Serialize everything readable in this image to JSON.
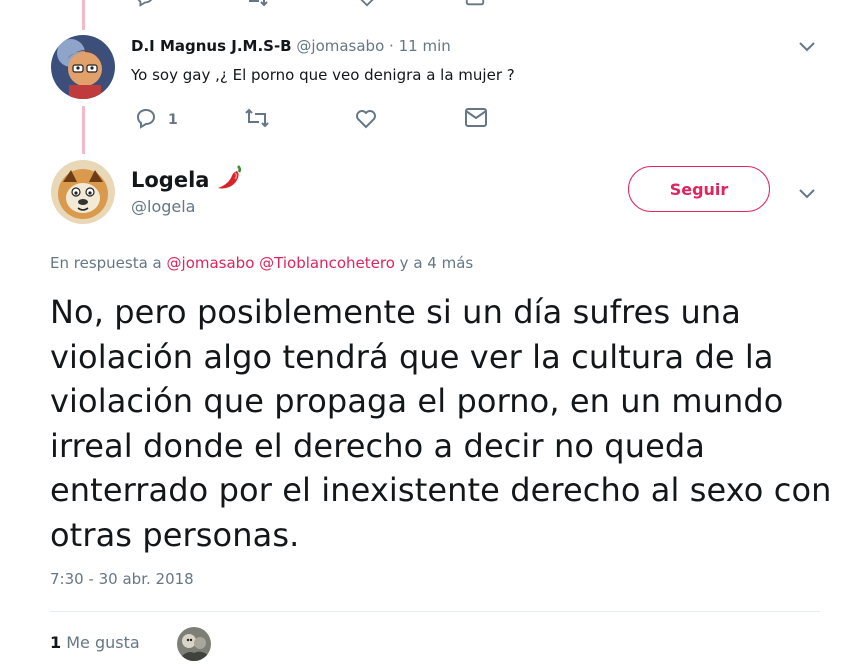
{
  "colors": {
    "accent": "#e0245e",
    "thread_line": "#f7b8c7",
    "muted": "#657786",
    "text": "#14171a",
    "divider": "#e6ecf0"
  },
  "reply_tweet": {
    "name": "D.I Magnus J.M.S-B",
    "handle": "@jomasabo",
    "separator": "·",
    "time": "11 min",
    "text": "Yo soy gay ,¿ El porno que veo denigra a la mujer ?",
    "reply_count": "1",
    "icons": [
      "reply-icon",
      "retweet-icon",
      "like-icon",
      "message-icon",
      "chevron-down-icon"
    ]
  },
  "main_tweet": {
    "name": "Logela",
    "emoji_icon": "chili-pepper-icon",
    "handle": "@logela",
    "follow_label": "Seguir",
    "in_reply_prefix": "En respuesta a",
    "in_reply_users": [
      "@jomasabo",
      "@Tioblancohetero"
    ],
    "in_reply_suffix": "y a 4 más",
    "text": "No, pero posiblemente si un día sufres una violación algo tendrá que ver la cultura de la violación que propaga el porno, en un mundo irreal donde el derecho a decir no queda enterrado por el inexistente derecho al sexo con otras personas.",
    "timestamp": "7:30 - 30 abr. 2018",
    "likes_count": "1",
    "likes_label": "Me gusta"
  }
}
